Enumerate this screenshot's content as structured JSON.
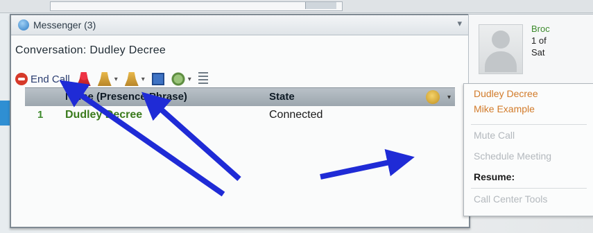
{
  "titlebar": {
    "title": "Messenger (3)",
    "dropdown_icon": "chevron-down-icon"
  },
  "conversation": {
    "prefix": "Conversation:",
    "participant": "Dudley Decree"
  },
  "toolbar": {
    "end_label": "End Call"
  },
  "grid": {
    "header_name": "Name (Presence Phrase)",
    "header_state": "State",
    "rows": [
      {
        "index": "1",
        "name": "Dudley Decree",
        "state": "Connected"
      }
    ]
  },
  "card": {
    "line1": "Broc",
    "line2": "1 of",
    "line3": "Sat"
  },
  "menu": {
    "items": [
      {
        "label": "Dudley Decree",
        "style": "orange"
      },
      {
        "label": "Mike Example",
        "style": "orange"
      },
      {
        "label": "Mute Call",
        "style": "gray"
      },
      {
        "label": "Schedule Meeting",
        "style": "gray"
      },
      {
        "label": "Resume:",
        "style": "dark"
      },
      {
        "label": "Call Center Tools",
        "style": "gray"
      }
    ]
  },
  "colors": {
    "accent_blue": "#2f8fd3",
    "arrow": "#1f2bd6",
    "contact_green": "#3a7a1c"
  }
}
